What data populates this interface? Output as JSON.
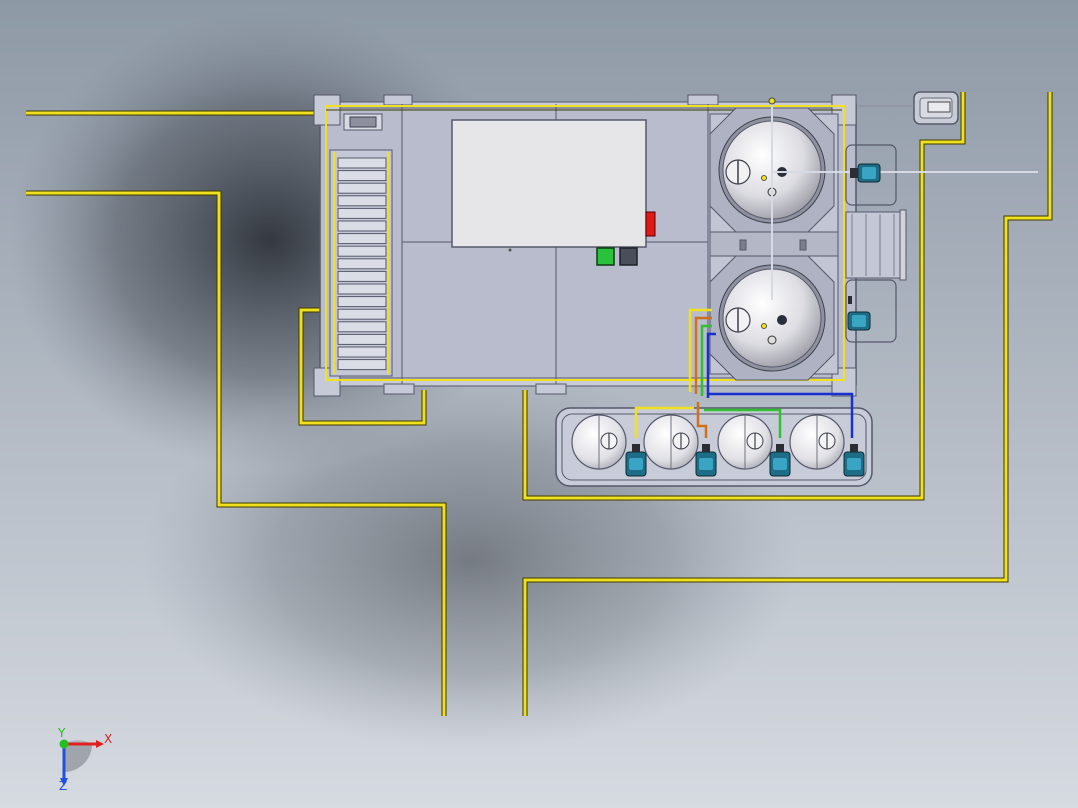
{
  "viewport": {
    "title": "",
    "background_top": "#8e99a6",
    "background_bottom": "#d6dae1"
  },
  "colors": {
    "pipe_yellow": "#f0e020",
    "pipe_yellow_dark": "#4a4600",
    "platform": "#b8bccd",
    "platform_edge": "#55586a",
    "control_panel": "#e6e6e8",
    "tank_light": "#f4f4f6",
    "tank_shade": "#a8a8b0",
    "pump_teal": "#1e6d86",
    "pump_teal_light": "#3aa5c2",
    "green_button": "#2ac23a",
    "red_indicator": "#e01818",
    "pipe_orange": "#d0701a",
    "pipe_green": "#30c030",
    "pipe_blue": "#1830d0",
    "axis_x": "#e02020",
    "axis_y": "#20c020",
    "axis_z": "#2050e0"
  },
  "components": {
    "large_tanks": [
      "fermentation-tank-1",
      "fermentation-tank-2"
    ],
    "small_tanks": [
      "storage-tank-1",
      "storage-tank-2",
      "storage-tank-3",
      "storage-tank-4"
    ],
    "icons": [
      "control-panel-icon",
      "stairs-icon",
      "pump-icon",
      "tank-icon",
      "axis-triad-icon"
    ]
  },
  "axes": {
    "x_label": "X",
    "y_label": "Y",
    "z_label": "Z"
  }
}
